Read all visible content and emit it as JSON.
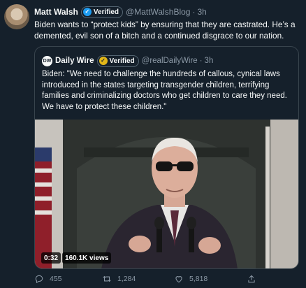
{
  "tweet": {
    "author_name": "Matt Walsh",
    "verified_label": "Verified",
    "handle": "@MattWalshBlog",
    "time": "3h",
    "text": "Biden wants to “protect kids” by ensuring that they are castrated. He’s a demented, evil son of a bitch and a continued disgrace to our nation."
  },
  "quote": {
    "logo": "DW",
    "author_name": "Daily Wire",
    "verified_label": "Verified",
    "handle": "@realDailyWire",
    "time": "3h",
    "text": "Biden: \"We need to challenge the hundreds of callous, cynical laws introduced in the states targeting transgender children, terrifying families and criminalizing doctors who get children to care they need. We have to protect these children.\"",
    "video_duration": "0:32",
    "video_views": "160.1K views"
  },
  "actions": {
    "replies": "455",
    "retweets": "1,284",
    "likes": "5,818"
  },
  "icons": {
    "verified": "verified-check-icon",
    "reply": "reply-icon",
    "retweet": "retweet-icon",
    "like": "heart-icon",
    "share": "share-icon"
  },
  "colors": {
    "background": "#15202b",
    "verified_blue": "#1d9bf0",
    "verified_gold": "#e2b719",
    "muted_text": "#8b98a5",
    "border": "#38444d"
  }
}
